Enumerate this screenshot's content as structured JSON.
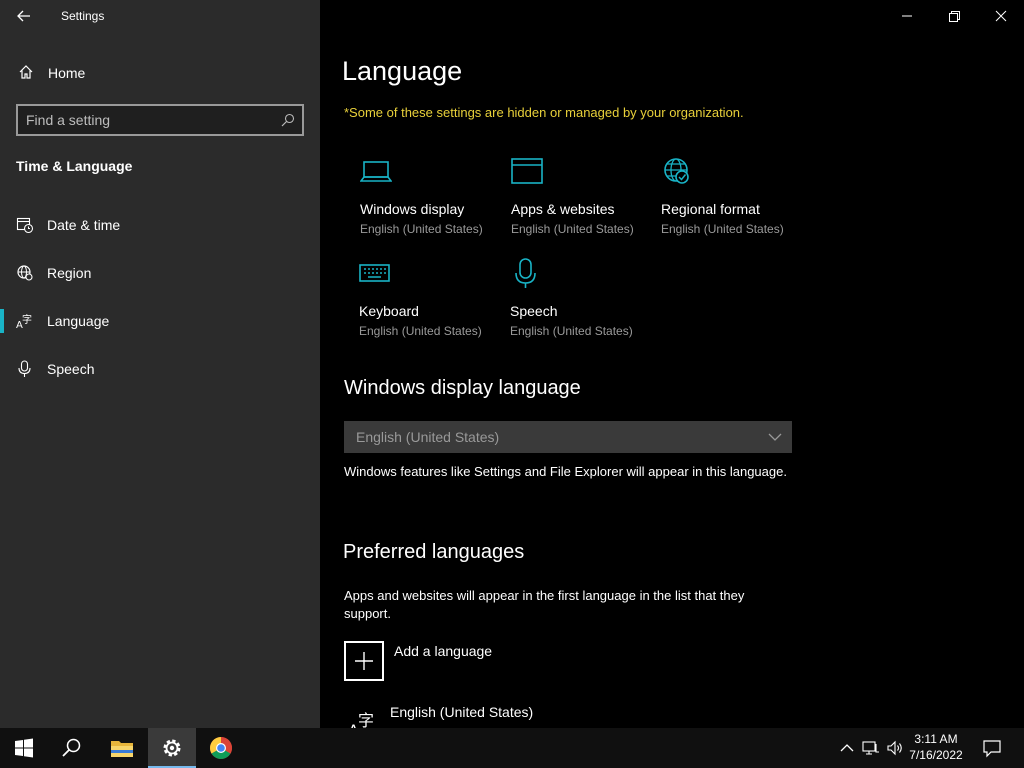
{
  "window": {
    "title": "Settings"
  },
  "sidebar": {
    "home_label": "Home",
    "search_placeholder": "Find a setting",
    "section_title": "Time & Language",
    "items": [
      {
        "label": "Date & time",
        "icon": "date-time-icon"
      },
      {
        "label": "Region",
        "icon": "region-icon"
      },
      {
        "label": "Language",
        "icon": "language-icon",
        "active": true
      },
      {
        "label": "Speech",
        "icon": "microphone-icon"
      }
    ]
  },
  "main": {
    "title": "Language",
    "notice": "*Some of these settings are hidden or managed by your organization.",
    "tiles": [
      {
        "name": "Windows display",
        "sub": "English (United States)",
        "icon": "laptop-icon"
      },
      {
        "name": "Apps & websites",
        "sub": "English (United States)",
        "icon": "browser-window-icon"
      },
      {
        "name": "Regional format",
        "sub": "English (United States)",
        "icon": "globe-icon"
      },
      {
        "name": "Keyboard",
        "sub": "English (United States)",
        "icon": "keyboard-icon"
      },
      {
        "name": "Speech",
        "sub": "English (United States)",
        "icon": "microphone-icon"
      }
    ],
    "display_language": {
      "heading": "Windows display language",
      "selected": "English (United States)",
      "description": "Windows features like Settings and File Explorer will appear in this language."
    },
    "preferred": {
      "heading": "Preferred languages",
      "description": "Apps and websites will appear in the first language in the list that they support.",
      "add_label": "Add a language",
      "languages": [
        "English (United States)"
      ]
    }
  },
  "taskbar": {
    "time": "3:11 AM",
    "date": "7/16/2022"
  },
  "colors": {
    "accent": "#19b3c6",
    "notice": "#e8d03a",
    "sidebar_bg": "#2b2b2b"
  }
}
